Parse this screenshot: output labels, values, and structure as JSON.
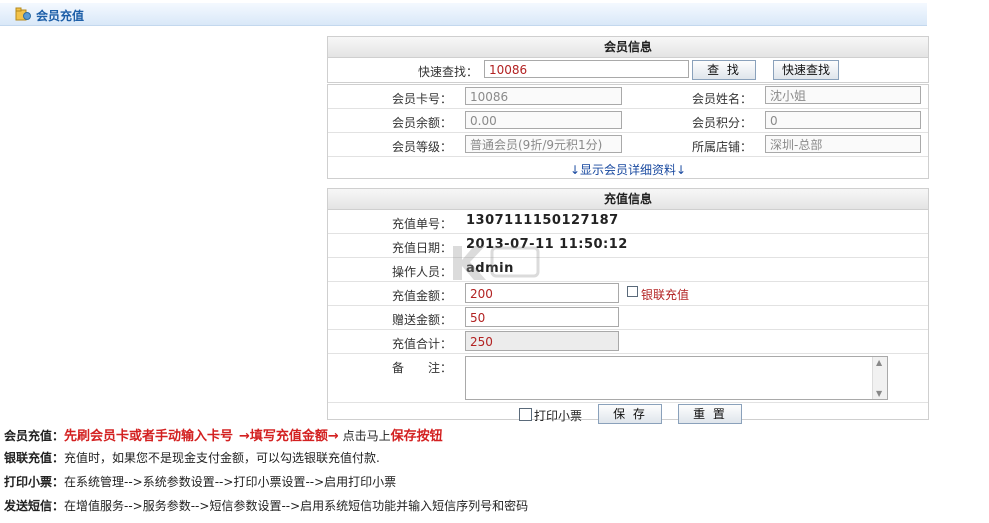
{
  "header": {
    "title": "会员充值",
    "icon": "folder-edit-icon"
  },
  "member_info": {
    "title": "会员信息",
    "quick_search": {
      "label": "快速查找：",
      "value": "10086",
      "find_button": "查 找",
      "quick_button": "快速查找"
    },
    "card_no": {
      "label": "会员卡号：",
      "value": "10086"
    },
    "name": {
      "label": "会员姓名：",
      "value": "沈小姐"
    },
    "balance": {
      "label": "会员余额：",
      "value": "0.00"
    },
    "points": {
      "label": "会员积分：",
      "value": "0"
    },
    "level": {
      "label": "会员等级：",
      "value": "普通会员(9折/9元积1分)"
    },
    "store": {
      "label": "所属店铺：",
      "value": "深圳-总部"
    },
    "detail_link": "↓显示会员详细资料↓"
  },
  "recharge_info": {
    "title": "充值信息",
    "order_no": {
      "label": "充值单号：",
      "value": "1307111150127187"
    },
    "date": {
      "label": "充值日期：",
      "value": "2013-07-11 11:50:12"
    },
    "operator": {
      "label": "操作人员：",
      "value": "admin"
    },
    "amount": {
      "label": "充值金额：",
      "value": "200"
    },
    "unionpay": {
      "label": "银联充值"
    },
    "gift": {
      "label": "赠送金额：",
      "value": "50"
    },
    "total": {
      "label": "充值合计：",
      "value": "250"
    },
    "remark": {
      "label": "备　　注：",
      "value": ""
    },
    "print_ticket": "打印小票",
    "save_button": "保 存",
    "reset_button": "重 置"
  },
  "notes": {
    "line1": {
      "title": "会员充值：",
      "step1": "先刷会员卡或者手动输入卡号",
      "step2": "→填写充值金额→",
      "plain": " 点击马上",
      "step3": "保存按钮"
    },
    "line2": {
      "title": "银联充值：",
      "text": "充值时，如果您不是现金支付金额，可以勾选银联充值付款."
    },
    "line3": {
      "title": "打印小票：",
      "text": "在系统管理-->系统参数设置-->打印小票设置-->启用打印小票"
    },
    "line4": {
      "title": "发送短信：",
      "text": "在增值服务-->服务参数-->短信参数设置-->启用系统短信功能并输入短信序列号和密码"
    }
  },
  "colors": {
    "accent_red": "#d32020",
    "title_blue": "#1d5fa8",
    "value_red": "#b22222"
  }
}
